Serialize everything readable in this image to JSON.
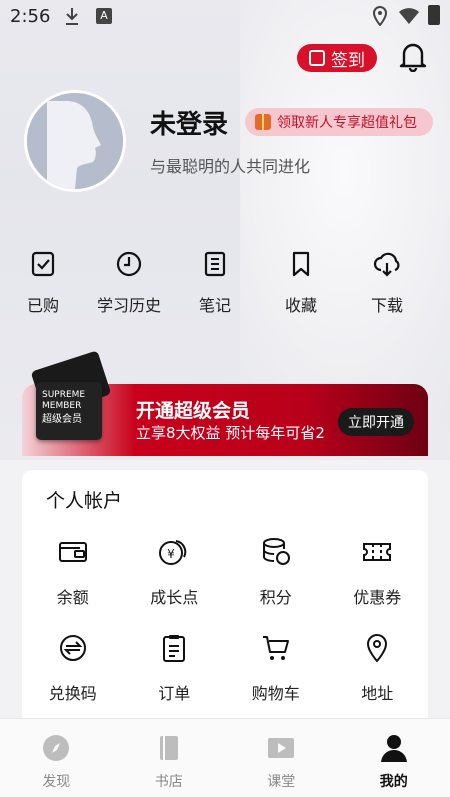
{
  "status_bar": {
    "time": "2:56",
    "a_badge": "A"
  },
  "header": {
    "checkin_label": "签到"
  },
  "profile": {
    "username": "未登录",
    "gift_promo": "领取新人专享超值礼包",
    "tagline": "与最聪明的人共同进化"
  },
  "quick_actions": [
    {
      "label": "已购",
      "icon": "purchased-icon"
    },
    {
      "label": "学习历史",
      "icon": "history-icon"
    },
    {
      "label": "笔记",
      "icon": "notes-icon"
    },
    {
      "label": "收藏",
      "icon": "bookmark-icon"
    },
    {
      "label": "下载",
      "icon": "download-icon"
    }
  ],
  "vip_banner": {
    "card_line1": "SUPREME",
    "card_line2": "MEMBER",
    "card_cn": "超级会员",
    "title": "开通超级会员",
    "subtitle": "立享8大权益 预计每年可省2",
    "button": "立即开通"
  },
  "account": {
    "title": "个人帐户",
    "items": [
      {
        "label": "余额",
        "icon": "balance-icon"
      },
      {
        "label": "成长点",
        "icon": "growth-points-icon"
      },
      {
        "label": "积分",
        "icon": "points-icon"
      },
      {
        "label": "优惠券",
        "icon": "coupon-icon"
      },
      {
        "label": "兑换码",
        "icon": "redeem-code-icon"
      },
      {
        "label": "订单",
        "icon": "orders-icon"
      },
      {
        "label": "购物车",
        "icon": "cart-icon"
      },
      {
        "label": "地址",
        "icon": "address-icon"
      }
    ]
  },
  "bottom_nav": [
    {
      "label": "发现",
      "active": false
    },
    {
      "label": "书店",
      "active": false
    },
    {
      "label": "课堂",
      "active": false
    },
    {
      "label": "我的",
      "active": true
    }
  ],
  "colors": {
    "brand_red": "#d8102a",
    "dark": "#1a1a1a"
  }
}
